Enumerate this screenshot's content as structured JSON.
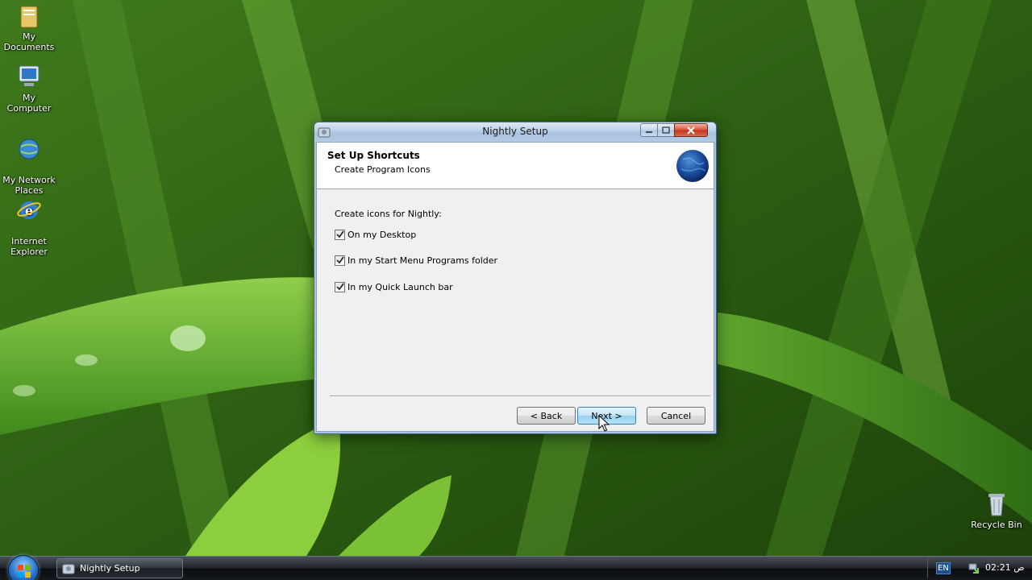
{
  "desktop": {
    "icons": [
      {
        "label": "My Documents",
        "icon": "folder-icon"
      },
      {
        "label": "My Computer",
        "icon": "computer-icon"
      },
      {
        "label": "My Network\nPlaces",
        "icon": "network-icon"
      },
      {
        "label": "Internet\nExplorer",
        "icon": "ie-icon"
      },
      {
        "label": "Recycle Bin",
        "icon": "recycle-bin-icon"
      }
    ]
  },
  "window": {
    "title": "Nightly Setup",
    "header": {
      "title": "Set Up Shortcuts",
      "subtitle": "Create Program Icons"
    },
    "prompt": "Create icons for Nightly:",
    "options": [
      {
        "label": "On my Desktop",
        "checked": true
      },
      {
        "label": "In my Start Menu Programs folder",
        "checked": true
      },
      {
        "label": "In my Quick Launch bar",
        "checked": true
      }
    ],
    "buttons": {
      "back": "< Back",
      "next": "Next >",
      "cancel": "Cancel"
    }
  },
  "taskbar": {
    "items": [
      {
        "label": "Nightly Setup"
      }
    ],
    "language": "EN",
    "clock": "02:21 ص"
  },
  "colors": {
    "titlebar": "#b9cfe8",
    "close_button": "#c43620",
    "dialog_background": "#f0f0f0",
    "taskbar": "#15181c"
  }
}
